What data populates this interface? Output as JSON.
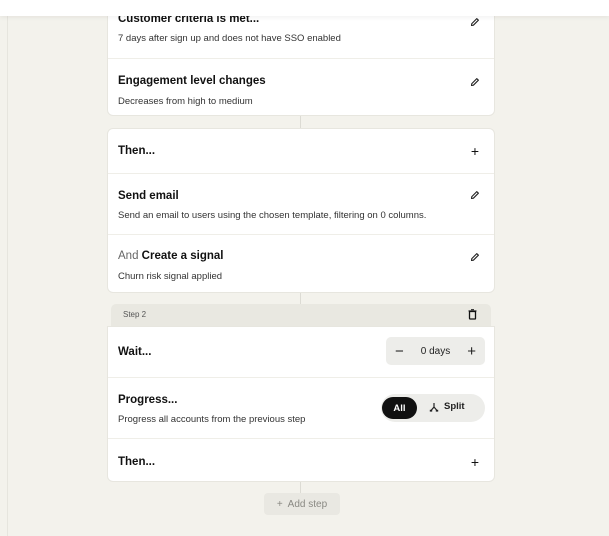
{
  "trigger_card": {
    "rows": [
      {
        "title": "Customer criteria is met...",
        "desc": "7 days after sign up and does not have SSO enabled"
      },
      {
        "title": "Engagement level changes",
        "desc": "Decreases from high to medium"
      }
    ]
  },
  "actions_card": {
    "then_label": "Then...",
    "send_email": {
      "title": "Send email",
      "desc": "Send an email to users using the chosen template, filtering on 0 columns."
    },
    "signal": {
      "prefix": "And",
      "title": "Create a signal",
      "desc": "Churn risk signal applied"
    }
  },
  "step2": {
    "label": "Step 2",
    "wait_label": "Wait...",
    "wait_value": "0 days",
    "minus": "−",
    "plus": "+",
    "progress_title": "Progress...",
    "progress_desc": "Progress all accounts from the previous step",
    "toggle_all": "All",
    "toggle_split": "Split",
    "then_label": "Then..."
  },
  "add_step": {
    "icon": "+",
    "label": "Add step"
  },
  "icons": {
    "edit": "pencil-icon",
    "add": "plus-icon",
    "delete": "trash-icon",
    "split": "split-icon"
  }
}
